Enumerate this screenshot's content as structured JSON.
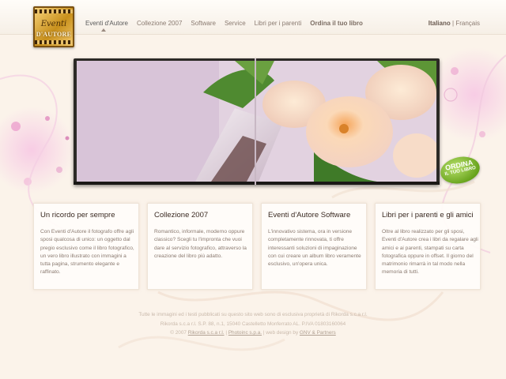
{
  "brand": {
    "logo_line1": "Eventi",
    "logo_line2": "D'AUTORE"
  },
  "nav": {
    "items": [
      {
        "label": "Eventi d'Autore"
      },
      {
        "label": "Collezione 2007"
      },
      {
        "label": "Software"
      },
      {
        "label": "Service"
      },
      {
        "label": "Libri per i parenti"
      },
      {
        "label": "Ordina il tuo libro"
      }
    ]
  },
  "lang": {
    "current": "Italiano",
    "separator": "|",
    "other": "Français"
  },
  "badge": {
    "line1": "ORDINA",
    "line2": "IL TUO LIBRO"
  },
  "boxes": [
    {
      "title": "Un ricordo per sempre",
      "text": "Con Eventi d'Autore il fotografo offre agli sposi qualcosa di unico: un oggetto dal pregio esclusivo come il libro fotografico, un vero libro illustrato con immagini a tutta pagina, strumento elegante e raffinato."
    },
    {
      "title": "Collezione 2007",
      "text": "Romantico, informale, moderno oppure classico? Scegli tu l'impronta che vuoi dare al servizio fotografico, attraverso la creazione del libro più adatto."
    },
    {
      "title": "Eventi d'Autore Software",
      "text": "L'innovativo sistema, ora in versione completamente rinnovata, ti offre interessanti soluzioni di impaginazione con cui creare un album libro veramente esclusivo, un'opera unica."
    },
    {
      "title": "Libri per i parenti e gli amici",
      "text": "Oltre al libro realizzato per gli sposi, Eventi d'Autore crea i libri da regalare agli amici e ai parenti, stampati su carta fotografica oppure in offset. Il giorno del matrimonio rimarrà in tal modo nella memoria di tutti."
    }
  ],
  "footer": {
    "line1": "Tutte le immagini ed i testi pubblicati su questo sito web sono di esclusiva proprietà di Rikorda s.c.a r.l.",
    "line2": "Rikorda s.c.a r.l. S.P. 88, n.1, 15040 Castelletto Monferrato AL. P.IVA 01803160064",
    "line3_prefix": "© 2007",
    "link1": "Rikorda s.c.a r.l.",
    "link2": "Photoinc s.p.a.",
    "line3_mid": "| web design by",
    "link3": "GNV & Partners"
  }
}
